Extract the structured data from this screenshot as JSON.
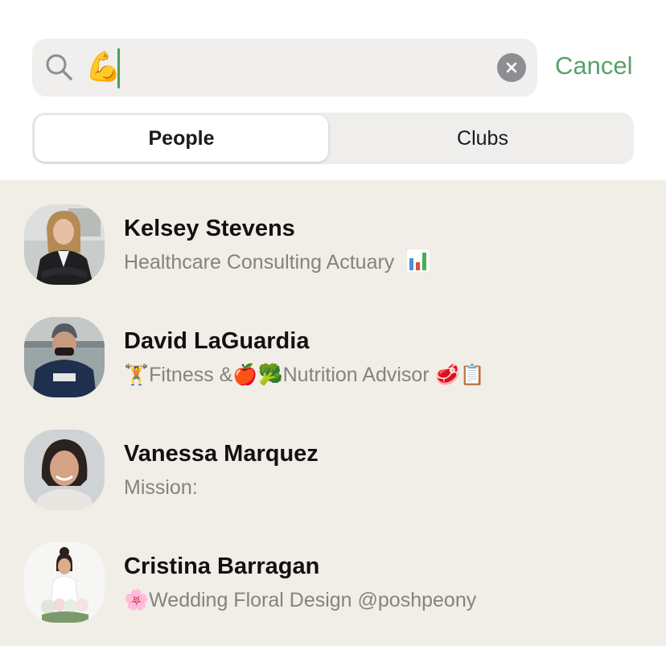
{
  "search": {
    "value": "💪",
    "placeholder": ""
  },
  "cancel_label": "Cancel",
  "tabs": [
    {
      "label": "People",
      "selected": true
    },
    {
      "label": "Clubs",
      "selected": false
    }
  ],
  "colors": {
    "accent": "#5aa06b",
    "list_background": "#f1eee7",
    "secondary_text": "#85837f"
  },
  "people": [
    {
      "name": "Kelsey Stevens",
      "bio": "Healthcare Consulting Actuary",
      "bio_icon": "bar-chart-icon"
    },
    {
      "name": "David LaGuardia",
      "bio_parts": [
        "🏋",
        "Fitness &",
        "🍎",
        "🥦",
        "Nutrition Advisor ",
        "🥩",
        "📋"
      ]
    },
    {
      "name": "Vanessa Marquez",
      "bio": "Mission:"
    },
    {
      "name": "Cristina Barragan",
      "bio_parts": [
        "🌸",
        "Wedding Floral Design @poshpeony"
      ]
    }
  ]
}
